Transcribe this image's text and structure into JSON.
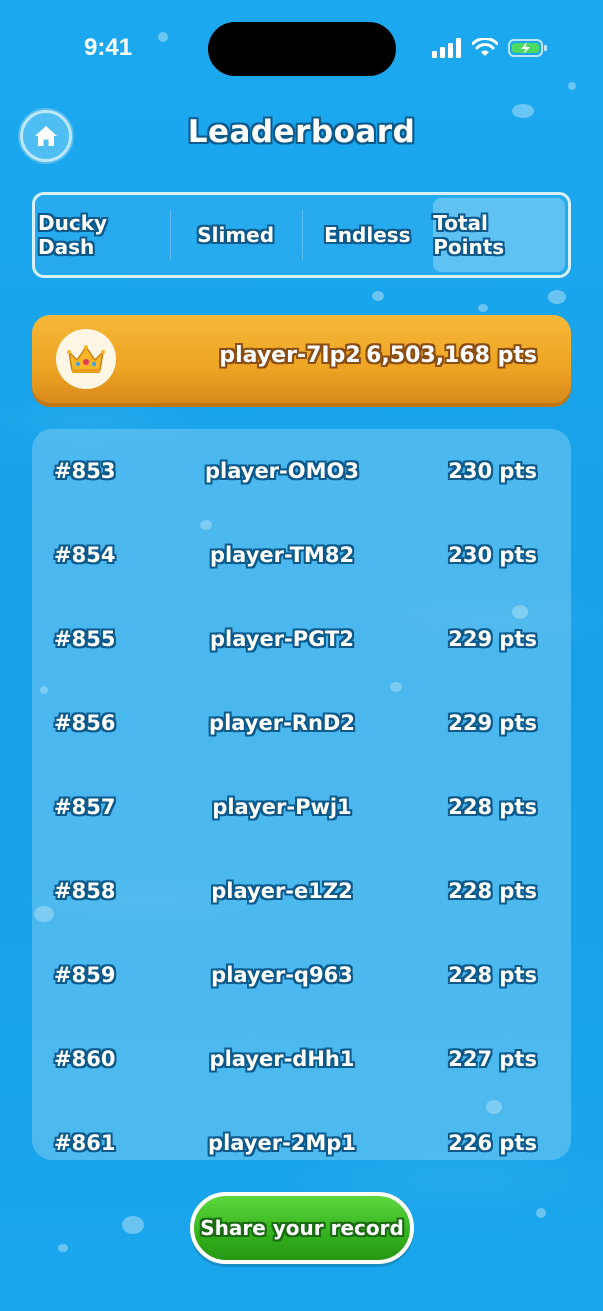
{
  "status_bar": {
    "time": "9:41"
  },
  "header": {
    "title": "Leaderboard",
    "home_icon": "home-icon"
  },
  "tabs": [
    {
      "label": "Ducky Dash",
      "active": false
    },
    {
      "label": "Slimed",
      "active": false
    },
    {
      "label": "Endless",
      "active": false
    },
    {
      "label": "Total Points",
      "active": true
    }
  ],
  "top_player": {
    "icon": "crown-icon",
    "name": "player-7Ip2",
    "points": "6,503,168 pts"
  },
  "leaderboard": [
    {
      "rank": "#853",
      "name": "player-OMO3",
      "points": "230 pts"
    },
    {
      "rank": "#854",
      "name": "player-TM82",
      "points": "230 pts"
    },
    {
      "rank": "#855",
      "name": "player-PGT2",
      "points": "229 pts"
    },
    {
      "rank": "#856",
      "name": "player-RnD2",
      "points": "229 pts"
    },
    {
      "rank": "#857",
      "name": "player-Pwj1",
      "points": "228 pts"
    },
    {
      "rank": "#858",
      "name": "player-e1Z2",
      "points": "228 pts"
    },
    {
      "rank": "#859",
      "name": "player-q963",
      "points": "228 pts"
    },
    {
      "rank": "#860",
      "name": "player-dHh1",
      "points": "227 pts"
    },
    {
      "rank": "#861",
      "name": "player-2Mp1",
      "points": "226 pts"
    }
  ],
  "share": {
    "label": "Share your record"
  },
  "colors": {
    "background": "#1aa6ec",
    "gold": "#f0a828",
    "green": "#36b520",
    "text_outline": "#0b5a8c"
  }
}
